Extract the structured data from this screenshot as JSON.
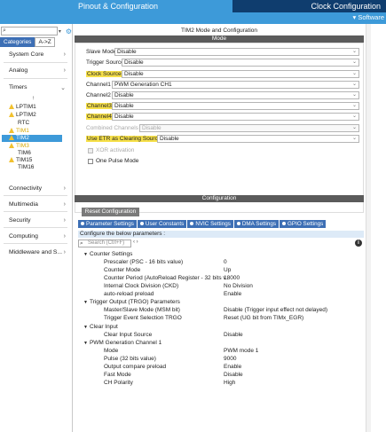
{
  "header": {
    "pinout_tab": "Pinout & Configuration",
    "clock_tab": "Clock Configuration",
    "software_label": "Software"
  },
  "sidebar": {
    "category_tabs": [
      "Categories",
      "A->Z"
    ],
    "categories_top": [
      "System Core",
      "Analog",
      "Timers"
    ],
    "timers": [
      "LPTIM1",
      "LPTIM2",
      "RTC",
      "TIM1",
      "TIM2",
      "TIM3",
      "TIM6",
      "TIM15",
      "TIM16"
    ],
    "categories_bottom": [
      "Connectivity",
      "Multimedia",
      "Security",
      "Computing",
      "Middleware and S..."
    ]
  },
  "mode_panel": {
    "title": "TIM2 Mode and Configuration",
    "header": "Mode",
    "fields": [
      {
        "label": "Slave Mode",
        "value": "Disable"
      },
      {
        "label": "Trigger Source",
        "value": "Disable"
      },
      {
        "label": "Clock Source",
        "value": "Disable"
      },
      {
        "label": "Channel1",
        "value": "PWM Generation CH1"
      },
      {
        "label": "Channel2",
        "value": "Disable"
      },
      {
        "label": "Channel3",
        "value": "Disable"
      },
      {
        "label": "Channel4",
        "value": "Disable"
      },
      {
        "label": "Combined Channels",
        "value": "Disable"
      },
      {
        "label": "Use ETR as Clearing Source",
        "value": "Disable"
      }
    ],
    "checkboxes": [
      "XOR activation",
      "One Pulse Mode"
    ]
  },
  "config_panel": {
    "header": "Configuration",
    "reset_button": "Reset Configuration",
    "tabs": [
      "Parameter Settings",
      "User Constants",
      "NVIC Settings",
      "DMA Settings",
      "GPIO Settings"
    ],
    "configure_text": "Configure the below parameters :",
    "search_placeholder": "Search (Ctrl+F)",
    "groups": [
      {
        "title": "Counter Settings",
        "params": [
          {
            "name": "Prescaler (PSC - 16 bits value)",
            "value": "0"
          },
          {
            "name": "Counter Mode",
            "value": "Up"
          },
          {
            "name": "Counter Period (AutoReload Register - 32 bits v...",
            "value": "18000"
          },
          {
            "name": "Internal Clock Division (CKD)",
            "value": "No Division"
          },
          {
            "name": "auto-reload preload",
            "value": "Enable"
          }
        ]
      },
      {
        "title": "Trigger Output (TRGO) Parameters",
        "params": [
          {
            "name": "Master/Slave Mode (MSM bit)",
            "value": "Disable (Trigger input effect not delayed)"
          },
          {
            "name": "Trigger Event Selection TRGO",
            "value": "Reset (UG bit from TIMx_EGR)"
          }
        ]
      },
      {
        "title": "Clear Input",
        "params": [
          {
            "name": "Clear Input Source",
            "value": "Disable"
          }
        ]
      },
      {
        "title": "PWM Generation Channel 1",
        "params": [
          {
            "name": "Mode",
            "value": "PWM mode 1"
          },
          {
            "name": "Pulse (32 bits value)",
            "value": "9000"
          },
          {
            "name": "Output compare preload",
            "value": "Enable"
          },
          {
            "name": "Fast Mode",
            "value": "Disable"
          },
          {
            "name": "CH Polarity",
            "value": "High"
          }
        ]
      }
    ]
  }
}
